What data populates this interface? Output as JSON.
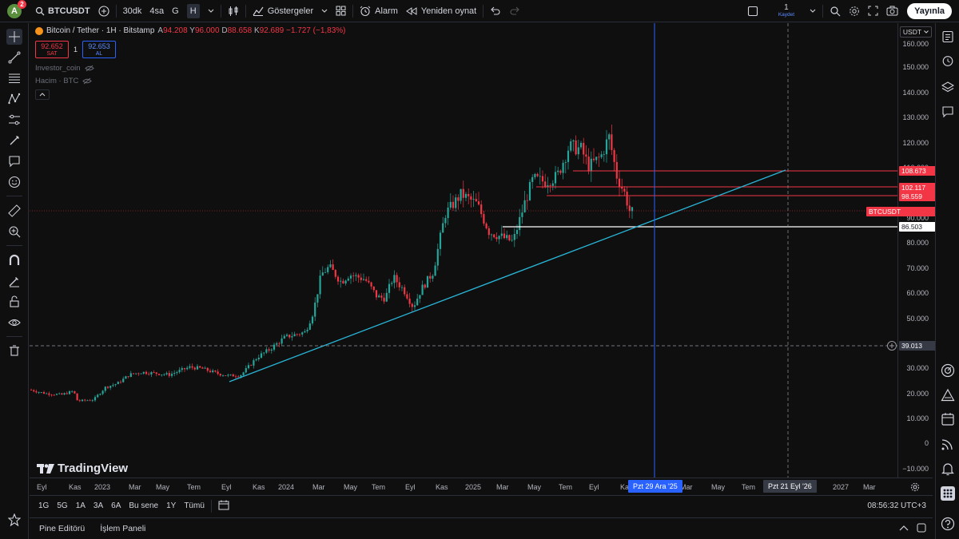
{
  "topbar": {
    "avatar_letter": "A",
    "avatar_badge": "2",
    "symbol": "BTCUSDT",
    "intervals": [
      "30dk",
      "4sa",
      "G",
      "H"
    ],
    "indicators_label": "Göstergeler",
    "alarm_label": "Alarm",
    "replay_label": "Yeniden oynat",
    "layout_count": "1",
    "layout_saved": "Kaydet",
    "publish_label": "Yayınla"
  },
  "legend": {
    "title": "Bitcoin / Tether · 1H · Bitstamp",
    "o_key": "A",
    "o_val": "94.208",
    "h_key": "Y",
    "h_val": "96.000",
    "l_key": "D",
    "l_val": "88.658",
    "c_key": "K",
    "c_val": "92.689",
    "change": "−1.727 (−1,83%)"
  },
  "buysell": {
    "sell_price": "92.652",
    "sell_label": "SAT",
    "spread": "1",
    "buy_price": "92.653",
    "buy_label": "AL"
  },
  "indicators": [
    "Investor_coin",
    "Hacim · BTC"
  ],
  "price_axis": {
    "currency": "USDT",
    "labels": [
      "160.000",
      "150.000",
      "140.000",
      "130.000",
      "120.000",
      "110.000",
      "90.000",
      "80.000",
      "70.000",
      "60.000",
      "50.000",
      "30.000",
      "20.000",
      "10.000",
      "0",
      "−10.000"
    ],
    "tag_108": "108.673",
    "tag_102": "102.117",
    "tag_98": "98.559",
    "tag_symbol": "BTCUSDT",
    "tag_86": "86.503",
    "crosshair_price": "39.013"
  },
  "time_axis": {
    "labels": [
      "Eyl",
      "Kas",
      "2023",
      "Mar",
      "May",
      "Tem",
      "Eyl",
      "Kas",
      "2024",
      "Mar",
      "May",
      "Tem",
      "Eyl",
      "Kas",
      "2025",
      "Mar",
      "May",
      "Tem",
      "Eyl",
      "Kas",
      "Mar",
      "May",
      "Tem",
      "2027",
      "Mar"
    ],
    "date_tag_1": "Pzt 29 Ara '25",
    "date_tag_2": "Pzt 21 Eyl '26"
  },
  "bottombar": {
    "ranges": [
      "1G",
      "5G",
      "1A",
      "3A",
      "6A",
      "Bu sene",
      "1Y",
      "Tümü"
    ],
    "clock": "08:56:32 UTC+3"
  },
  "footer": {
    "pine_label": "Pine Editörü",
    "trade_label": "İşlem Paneli"
  },
  "watermark": "TradingView",
  "colors": {
    "up": "#26a69a",
    "down": "#f23645",
    "trendline": "#29b6d8",
    "support": "#ffffff",
    "blue_vline": "#2962ff"
  }
}
